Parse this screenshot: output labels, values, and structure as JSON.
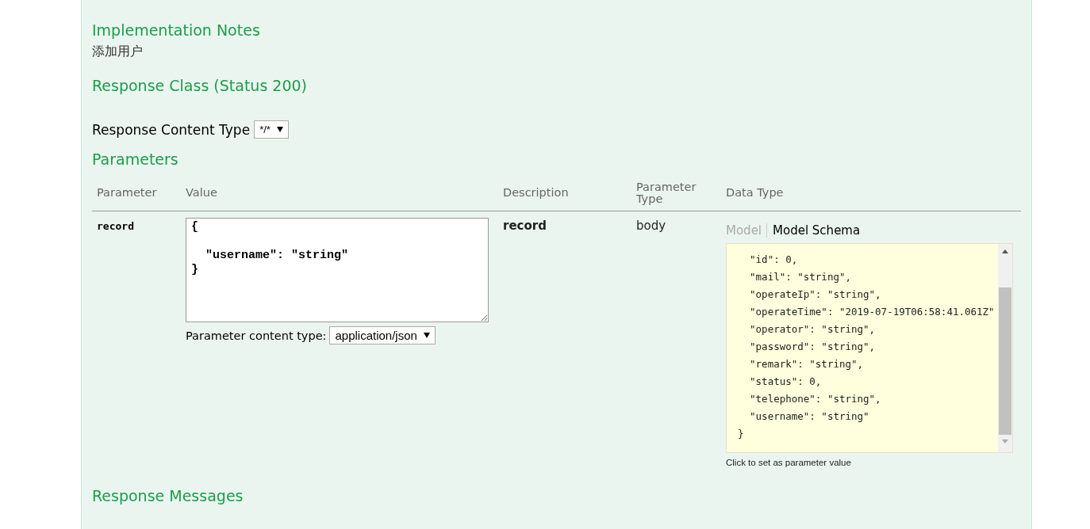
{
  "implementation_notes": {
    "heading": "Implementation Notes",
    "text": "添加用户"
  },
  "response_class": {
    "heading": "Response Class (Status 200)"
  },
  "response_content_type": {
    "label": "Response Content Type",
    "value": "*/*"
  },
  "parameters": {
    "heading": "Parameters",
    "columns": [
      {
        "label": "Parameter"
      },
      {
        "label": "Value"
      },
      {
        "label": "Description"
      },
      {
        "label": "Parameter Type"
      },
      {
        "label": "Data Type"
      }
    ],
    "rows": [
      {
        "parameter": "record",
        "value": "{\n\n  \"username\": \"string\"\n}",
        "content_type_label": "Parameter content type:",
        "content_type": "application/json",
        "description": "record",
        "parameter_type": "body",
        "data_type": {
          "tabs": [
            {
              "label": "Model",
              "selected": false
            },
            {
              "label": "Model Schema",
              "selected": true
            }
          ],
          "schema_lines": [
            "  \"id\": 0,",
            "  \"mail\": \"string\",",
            "  \"operateIp\": \"string\",",
            "  \"operateTime\": \"2019-07-19T06:58:41.061Z\"",
            "  \"operator\": \"string\",",
            "  \"password\": \"string\",",
            "  \"remark\": \"string\",",
            "  \"status\": 0,",
            "  \"telephone\": \"string\",",
            "  \"username\": \"string\"",
            "}"
          ],
          "hint": "Click to set as parameter value"
        }
      }
    ]
  },
  "response_messages": {
    "heading": "Response Messages"
  }
}
